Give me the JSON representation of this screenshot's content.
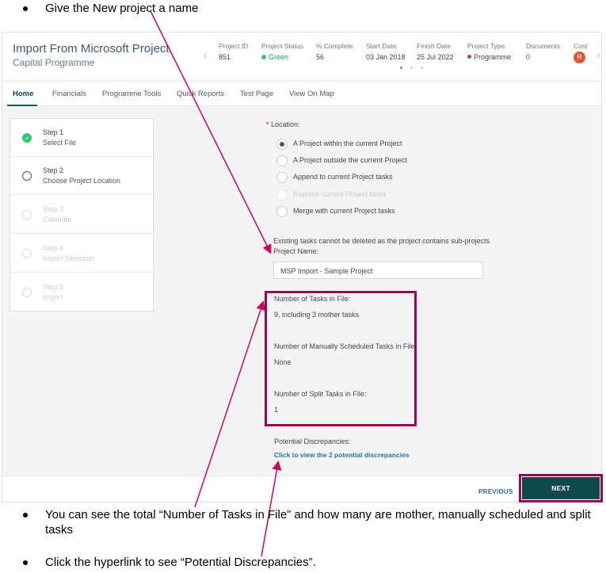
{
  "instructions": {
    "bullet1": "Give the New project a name",
    "bullet2": "You can see the total “Number of Tasks in File” and how many are mother, manually scheduled and split tasks",
    "bullet3": "Click the hyperlink to see “Potential Discrepancies”."
  },
  "header": {
    "title": "Import From Microsoft Project",
    "subtitle": "Capital Programme",
    "stats": [
      {
        "label": "Project ID",
        "value": "851"
      },
      {
        "label": "Project Status",
        "value": "Green"
      },
      {
        "label": "% Complete",
        "value": "56"
      },
      {
        "label": "Start Date",
        "value": "03 Jan 2018"
      },
      {
        "label": "Finish Date",
        "value": "25 Jul 2022"
      },
      {
        "label": "Project Type",
        "value": "Programme"
      },
      {
        "label": "Documents",
        "value": "0"
      },
      {
        "label": "Cost",
        "value": "R"
      }
    ],
    "colors": {
      "status_green": "#2ecc71",
      "programme_purple": "#8e44ad",
      "cost_badge": "#e55336"
    }
  },
  "tabs": [
    "Home",
    "Financials",
    "Programme Tools",
    "Quick Reports",
    "Test Page",
    "View On Map"
  ],
  "steps": [
    {
      "title": "Step 1",
      "desc": "Select File",
      "state": "done"
    },
    {
      "title": "Step 2",
      "desc": "Choose Project Location",
      "state": "current"
    },
    {
      "title": "Step 3",
      "desc": "Calendar",
      "state": "disabled"
    },
    {
      "title": "Step 4",
      "desc": "Import Selection",
      "state": "disabled"
    },
    {
      "title": "Step 5",
      "desc": "Import",
      "state": "disabled"
    }
  ],
  "form": {
    "location_label": "Location:",
    "required_mark": "*",
    "options": [
      {
        "label": "A Project within the current Project",
        "selected": true,
        "disabled": false
      },
      {
        "label": "A Project outside the current Project",
        "selected": false,
        "disabled": false
      },
      {
        "label": "Append to current Project tasks",
        "selected": false,
        "disabled": false
      },
      {
        "label": "Replace current Project tasks",
        "selected": false,
        "disabled": true
      },
      {
        "label": "Merge with current Project tasks",
        "selected": false,
        "disabled": false
      }
    ],
    "note": "Existing tasks cannot be deleted as the project contains sub-projects",
    "project_name_label": "Project Name:",
    "project_name_value": "MSP Import - Sample Project"
  },
  "info": {
    "tasks_label": "Number of Tasks in File:",
    "tasks_value": "9, including 3 mother tasks",
    "manual_label": "Number of Manually Scheduled Tasks in File:",
    "manual_value": "None",
    "split_label": "Number of Split Tasks in File:",
    "split_value": "1",
    "discrepancies_label": "Potential Discrepancies:",
    "discrepancies_link": "Click to view the 2 potential discrepancies"
  },
  "footer": {
    "previous": "PREVIOUS",
    "next": "NEXT"
  },
  "annotation_color": "#98065a"
}
